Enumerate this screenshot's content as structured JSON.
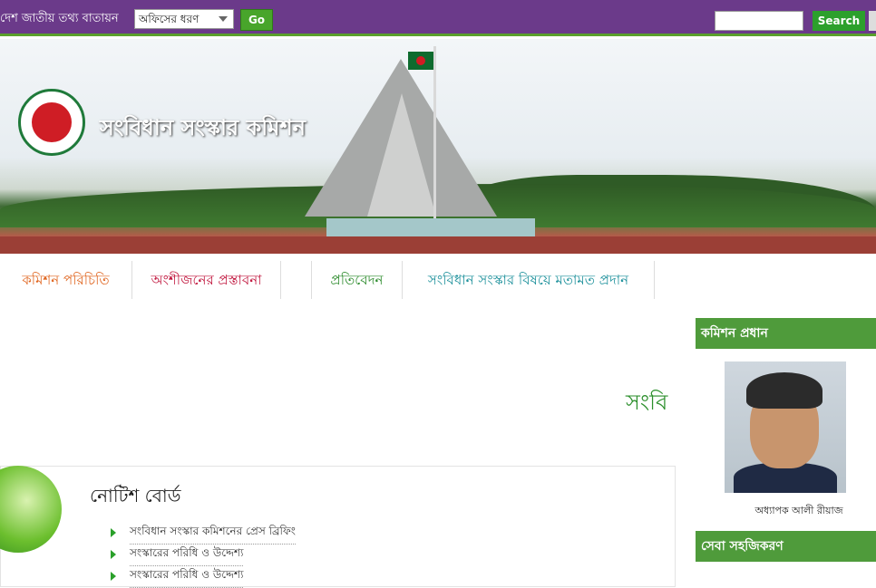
{
  "topbar": {
    "portal_title": "দেশ জাতীয় তথ্য বাতায়ন",
    "office_select_value": "অফিসের ধরণ",
    "go_label": "Go",
    "search_label": "Search"
  },
  "banner": {
    "title": "সংবিধান সংস্কার কমিশন"
  },
  "nav": {
    "items": [
      {
        "label": "কমিশন পরিচিতি",
        "color": "#e0651f"
      },
      {
        "label": "অংশীজনের প্রস্তাবনা",
        "color": "#c0143c"
      },
      {
        "label": "প্রতিবেদন",
        "color": "#2a8a2a"
      },
      {
        "label": "সংবিধান সংস্কার বিষয়ে মতামত প্রদান",
        "color": "#1a8f9a"
      }
    ]
  },
  "main": {
    "heading": "সংবি"
  },
  "notice_board": {
    "title": "নোটিশ বোর্ড",
    "items": [
      "সংবিধান সংস্কার কমিশনের প্রেস ব্রিফিং",
      "সংস্কারের পরিধি ও উদ্দেশ্য",
      "সংস্কারের পরিধি ও উদ্দেশ্য"
    ]
  },
  "sidebar": {
    "chief_header": "কমিশন প্রধান",
    "chief_name": "অধ্যাপক আলী রীয়াজ",
    "service_header": "সেবা সহজিকরণ"
  },
  "colors": {
    "topbar": "#6b3a8a",
    "accent_green": "#4f9b3b"
  }
}
